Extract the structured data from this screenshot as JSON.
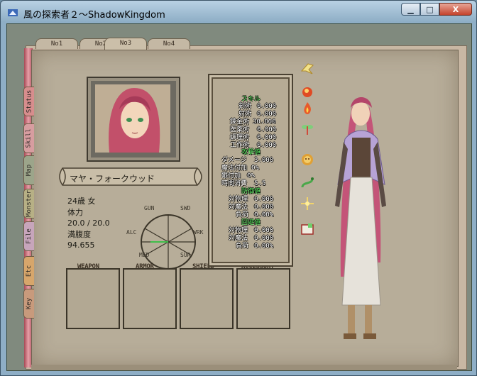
{
  "window": {
    "title": "風の探索者２〜ShadowKingdom",
    "minimize_label": "▁",
    "maximize_label": "□",
    "close_label": "X"
  },
  "tabs": [
    "No1",
    "No2",
    "No3",
    "No4"
  ],
  "side_tabs": [
    "Status",
    "Skill",
    "Map",
    "Monster",
    "File",
    "Etc",
    "Key"
  ],
  "character": {
    "name": "マヤ・フォークウッド",
    "age_sex": "24歳 女",
    "hp_label": "体力",
    "hp_value": "20.0 / 20.0",
    "fullness_label": "満腹度",
    "fullness_value": "94.655"
  },
  "radar": {
    "labels": [
      "GUN",
      "SWD",
      "WRK",
      "SUR",
      "MED",
      "ALC"
    ]
  },
  "equipment": [
    "WEAPON",
    "ARMOR",
    "SHIELD",
    "ACCESSORY"
  ],
  "skills": {
    "header": "スキル",
    "rows": [
      {
        "label": "剣術",
        "value": "0.000"
      },
      {
        "label": "射術",
        "value": "0.000"
      },
      {
        "label": "錬金術",
        "value": "30.000"
      },
      {
        "label": "医薬術",
        "value": "0.000"
      },
      {
        "label": "調理術",
        "value": "0.000"
      },
      {
        "label": "工作術",
        "value": "0.000"
      }
    ]
  },
  "attack": {
    "header": "攻撃値",
    "rows": [
      {
        "label": "ダメージ",
        "value": "3.000"
      },
      {
        "label": "魔法付加",
        "value": "0%"
      },
      {
        "label": "銀付加",
        "value": "0%"
      },
      {
        "label": "時間消費",
        "value": "5.5"
      }
    ]
  },
  "defense": {
    "header": "防御値",
    "rows": [
      {
        "label": "対物理",
        "value": "0.000"
      },
      {
        "label": "対魔法",
        "value": "0.000"
      },
      {
        "label": "負荷",
        "value": "0.00%"
      }
    ]
  },
  "evasion": {
    "header": "回避値",
    "rows": [
      {
        "label": "対物理",
        "value": "0.000"
      },
      {
        "label": "対魔法",
        "value": "0.000"
      },
      {
        "label": "負荷",
        "value": "0.00%"
      }
    ]
  },
  "colors": {
    "skill_header": "#52e05a",
    "panel_bg": "#b6ab95",
    "book_bg": "#b7ad99"
  }
}
